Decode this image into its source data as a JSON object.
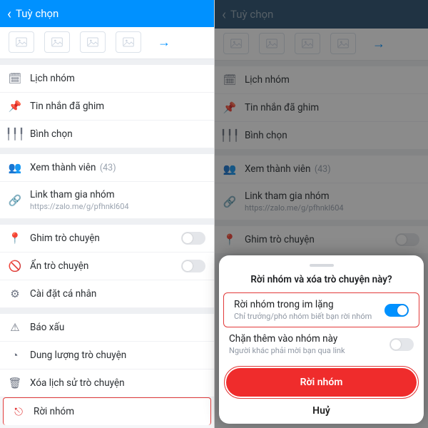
{
  "header": {
    "title": "Tuỳ chọn"
  },
  "media": {
    "more_icon": "arrow-right"
  },
  "rows": {
    "calendar": {
      "label": "Lịch nhóm"
    },
    "pinned": {
      "label": "Tin nhắn đã ghim"
    },
    "poll": {
      "label": "Bình chọn"
    },
    "members": {
      "label": "Xem thành viên",
      "count": "(43)"
    },
    "link": {
      "label": "Link tham gia nhóm",
      "sub": "https://zalo.me/g/pfhnkl604"
    },
    "pinchat": {
      "label": "Ghim trò chuyện"
    },
    "hidechat": {
      "label": "Ẩn trò chuyện"
    },
    "personal": {
      "label": "Cài đặt cá nhân"
    },
    "report": {
      "label": "Báo xấu"
    },
    "storage": {
      "label": "Dung lượng trò chuyện"
    },
    "clear": {
      "label": "Xóa lịch sử trò chuyện"
    },
    "leave": {
      "label": "Rời nhóm"
    }
  },
  "modal": {
    "title": "Rời nhóm và xóa trò chuyện này?",
    "opt1": {
      "t1": "Rời nhóm trong im lặng",
      "t2": "Chỉ trưởng/phó nhóm biết bạn rời nhóm"
    },
    "opt2": {
      "t1": "Chặn thêm vào nhóm này",
      "t2": "Người khác phải mời bạn qua link"
    },
    "confirm": "Rời nhóm",
    "cancel": "Huỷ"
  }
}
